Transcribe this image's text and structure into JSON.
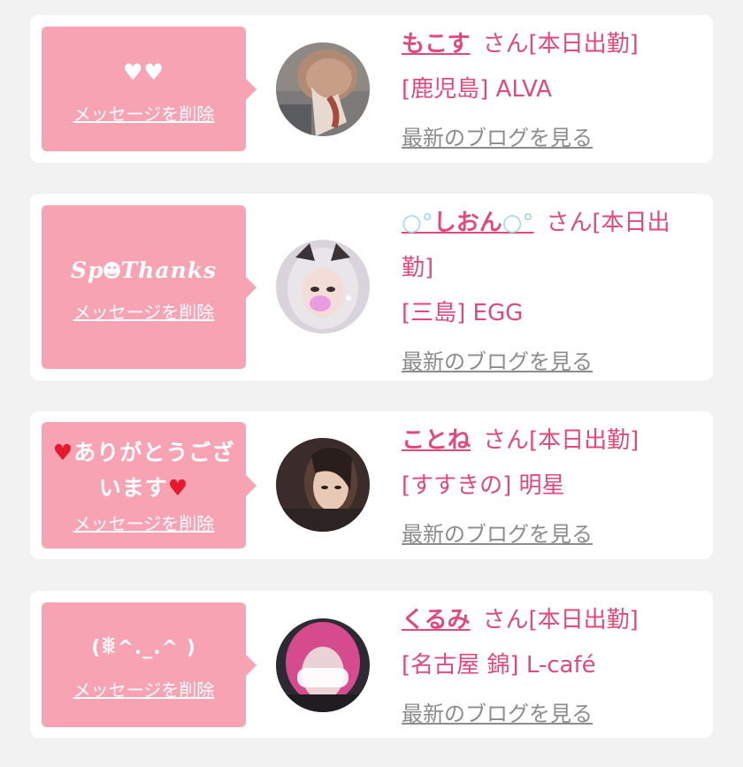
{
  "delete_label": "メッセージを削除",
  "san_label": "さん[本日出勤]",
  "blog_label": "最新のブログを見る",
  "colors": {
    "background": "#f2f2f2",
    "card": "#ffffff",
    "bubble": "#f8a3b4",
    "accent": "#e0497a",
    "link_gray": "#8c8c8c"
  },
  "messages": [
    {
      "message_icons": [
        "white-heart-icon",
        "white-heart-icon"
      ],
      "message_glyphs": "🤍🤍",
      "name": "もこす",
      "area": "[鹿児島] ALVA"
    },
    {
      "message_prefix": "Sp",
      "message_suffix": "Thanks",
      "message_icons": [
        "smile-icon"
      ],
      "name": "しおん",
      "name_icons": [
        "bubble-icon",
        "bubble-icon"
      ],
      "area": "[三島] EGG"
    },
    {
      "message_text": "ありがとうございます",
      "message_icons": [
        "red-heart-icon",
        "red-heart-icon"
      ],
      "name": "ことね",
      "area": "[すすきの] 明星"
    },
    {
      "message_text": "(ꒌ^._.^ )",
      "name": "くるみ",
      "area": "[名古屋 錦] L-café"
    }
  ]
}
